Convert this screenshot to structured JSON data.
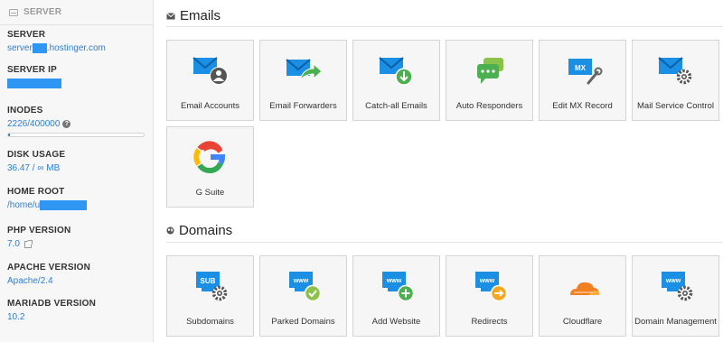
{
  "sidebar": {
    "header": "SERVER",
    "server": {
      "label": "SERVER",
      "prefix": "server",
      "suffix": ".hostinger.com"
    },
    "server_ip": {
      "label": "SERVER IP"
    },
    "inodes": {
      "label": "INODES",
      "value": "2226/400000",
      "usage_fraction": 0.0056
    },
    "disk_usage": {
      "label": "DISK USAGE",
      "value": "36.47 / ∞ MB"
    },
    "home_root": {
      "label": "HOME ROOT",
      "prefix": "/home/u"
    },
    "php_version": {
      "label": "PHP VERSION",
      "value": "7.0"
    },
    "apache_version": {
      "label": "APACHE VERSION",
      "value": "Apache/2.4"
    },
    "mariadb_version": {
      "label": "MARIADB VERSION",
      "value": "10.2"
    }
  },
  "emails": {
    "title": "Emails",
    "tiles": [
      {
        "label": "Email Accounts",
        "icon": "email-accounts-icon"
      },
      {
        "label": "Email Forwarders",
        "icon": "email-forwarders-icon"
      },
      {
        "label": "Catch-all Emails",
        "icon": "catch-all-emails-icon"
      },
      {
        "label": "Auto Responders",
        "icon": "auto-responders-icon"
      },
      {
        "label": "Edit MX Record",
        "icon": "edit-mx-record-icon",
        "badge": "MX"
      },
      {
        "label": "Mail Service Control",
        "icon": "mail-service-control-icon"
      },
      {
        "label": "G Suite",
        "icon": "g-suite-icon"
      }
    ]
  },
  "domains": {
    "title": "Domains",
    "tiles": [
      {
        "label": "Subdomains",
        "icon": "subdomains-icon",
        "badge": "SUB"
      },
      {
        "label": "Parked Domains",
        "icon": "parked-domains-icon",
        "badge": "www"
      },
      {
        "label": "Add Website",
        "icon": "add-website-icon",
        "badge": "www"
      },
      {
        "label": "Redirects",
        "icon": "redirects-icon",
        "badge": "www"
      },
      {
        "label": "Cloudflare",
        "icon": "cloudflare-icon"
      },
      {
        "label": "Domain Management",
        "icon": "domain-management-icon",
        "badge": "www"
      }
    ]
  },
  "colors": {
    "link": "#2b7fd8",
    "accent_blue": "#1a8fe3",
    "redaction": "#2f96f3"
  }
}
